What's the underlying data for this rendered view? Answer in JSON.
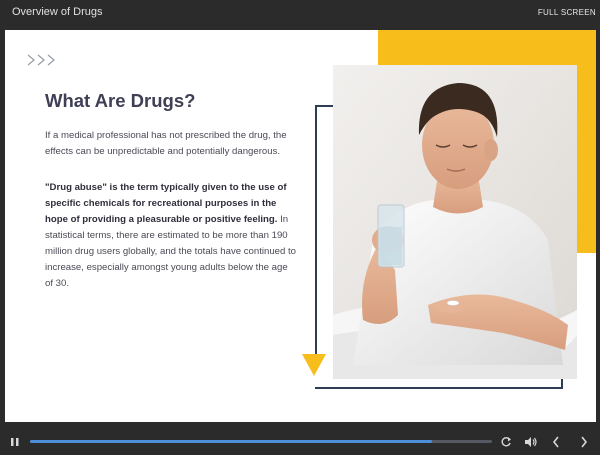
{
  "window": {
    "title": "Overview of Drugs",
    "fullscreen_label": "FULL SCREEN"
  },
  "slide": {
    "heading": "What Are Drugs?",
    "paragraph1": "If a medical professional has not prescribed the drug, the effects can be unpredictable and potentially dangerous.",
    "paragraph2_bold": "\"Drug abuse\" is the term typically given to the use of specific chemicals for recreational purposes in the hope of providing a pleasurable or positive feeling.",
    "paragraph2_rest": " In statistical terms, there are estimated to be more than 190 million drug users globally, and the totals have continued to increase, especially amongst young adults below the age of 30.",
    "accent_color": "#f7bd1b",
    "frame_color": "#2d3e53",
    "image_icon": "man-holding-water-and-pills-photo"
  },
  "player": {
    "progress": 0.87,
    "progress_color": "#4d8ed8",
    "icons": [
      "pause-icon",
      "replay-icon",
      "volume-icon",
      "previous-icon",
      "next-icon"
    ]
  }
}
